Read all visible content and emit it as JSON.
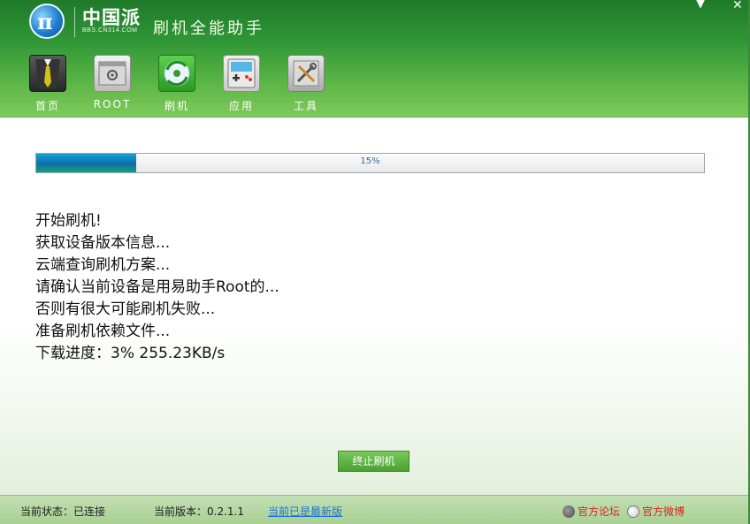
{
  "window": {
    "logo_glyph": "π",
    "logo_text": "中国派",
    "logo_sub": "BBS.CN314.COM",
    "app_title": "刷机全能助手",
    "minimize_symbol": "▼",
    "close_symbol": "✕"
  },
  "nav": {
    "items": [
      {
        "label": "首页",
        "icon": "suit-tie-icon"
      },
      {
        "label": "ROOT",
        "icon": "root-panel-icon"
      },
      {
        "label": "刷机",
        "icon": "flash-disc-icon"
      },
      {
        "label": "应用",
        "icon": "game-app-icon"
      },
      {
        "label": "工具",
        "icon": "tools-icon"
      }
    ]
  },
  "progress": {
    "value": 0.15,
    "text": "15%"
  },
  "log": [
    "开始刷机!",
    "获取设备版本信息...",
    "云端查询刷机方案...",
    "请确认当前设备是用易助手Root的...",
    "否则有很大可能刷机失败...",
    "准备刷机依赖文件...",
    "下载进度：3% 255.23KB/s"
  ],
  "actions": {
    "stop_label": "终止刷机"
  },
  "status": {
    "connection": "当前状态：已连接",
    "version": "当前版本：0.2.1.1",
    "update": "当前已是最新版",
    "forum": "官方论坛",
    "weibo": "官方微博"
  },
  "colors": {
    "header_green": "#2f9636",
    "progress_blue": "#1177b6",
    "link_blue": "#1a6fd6",
    "link_red": "#d9261c"
  }
}
